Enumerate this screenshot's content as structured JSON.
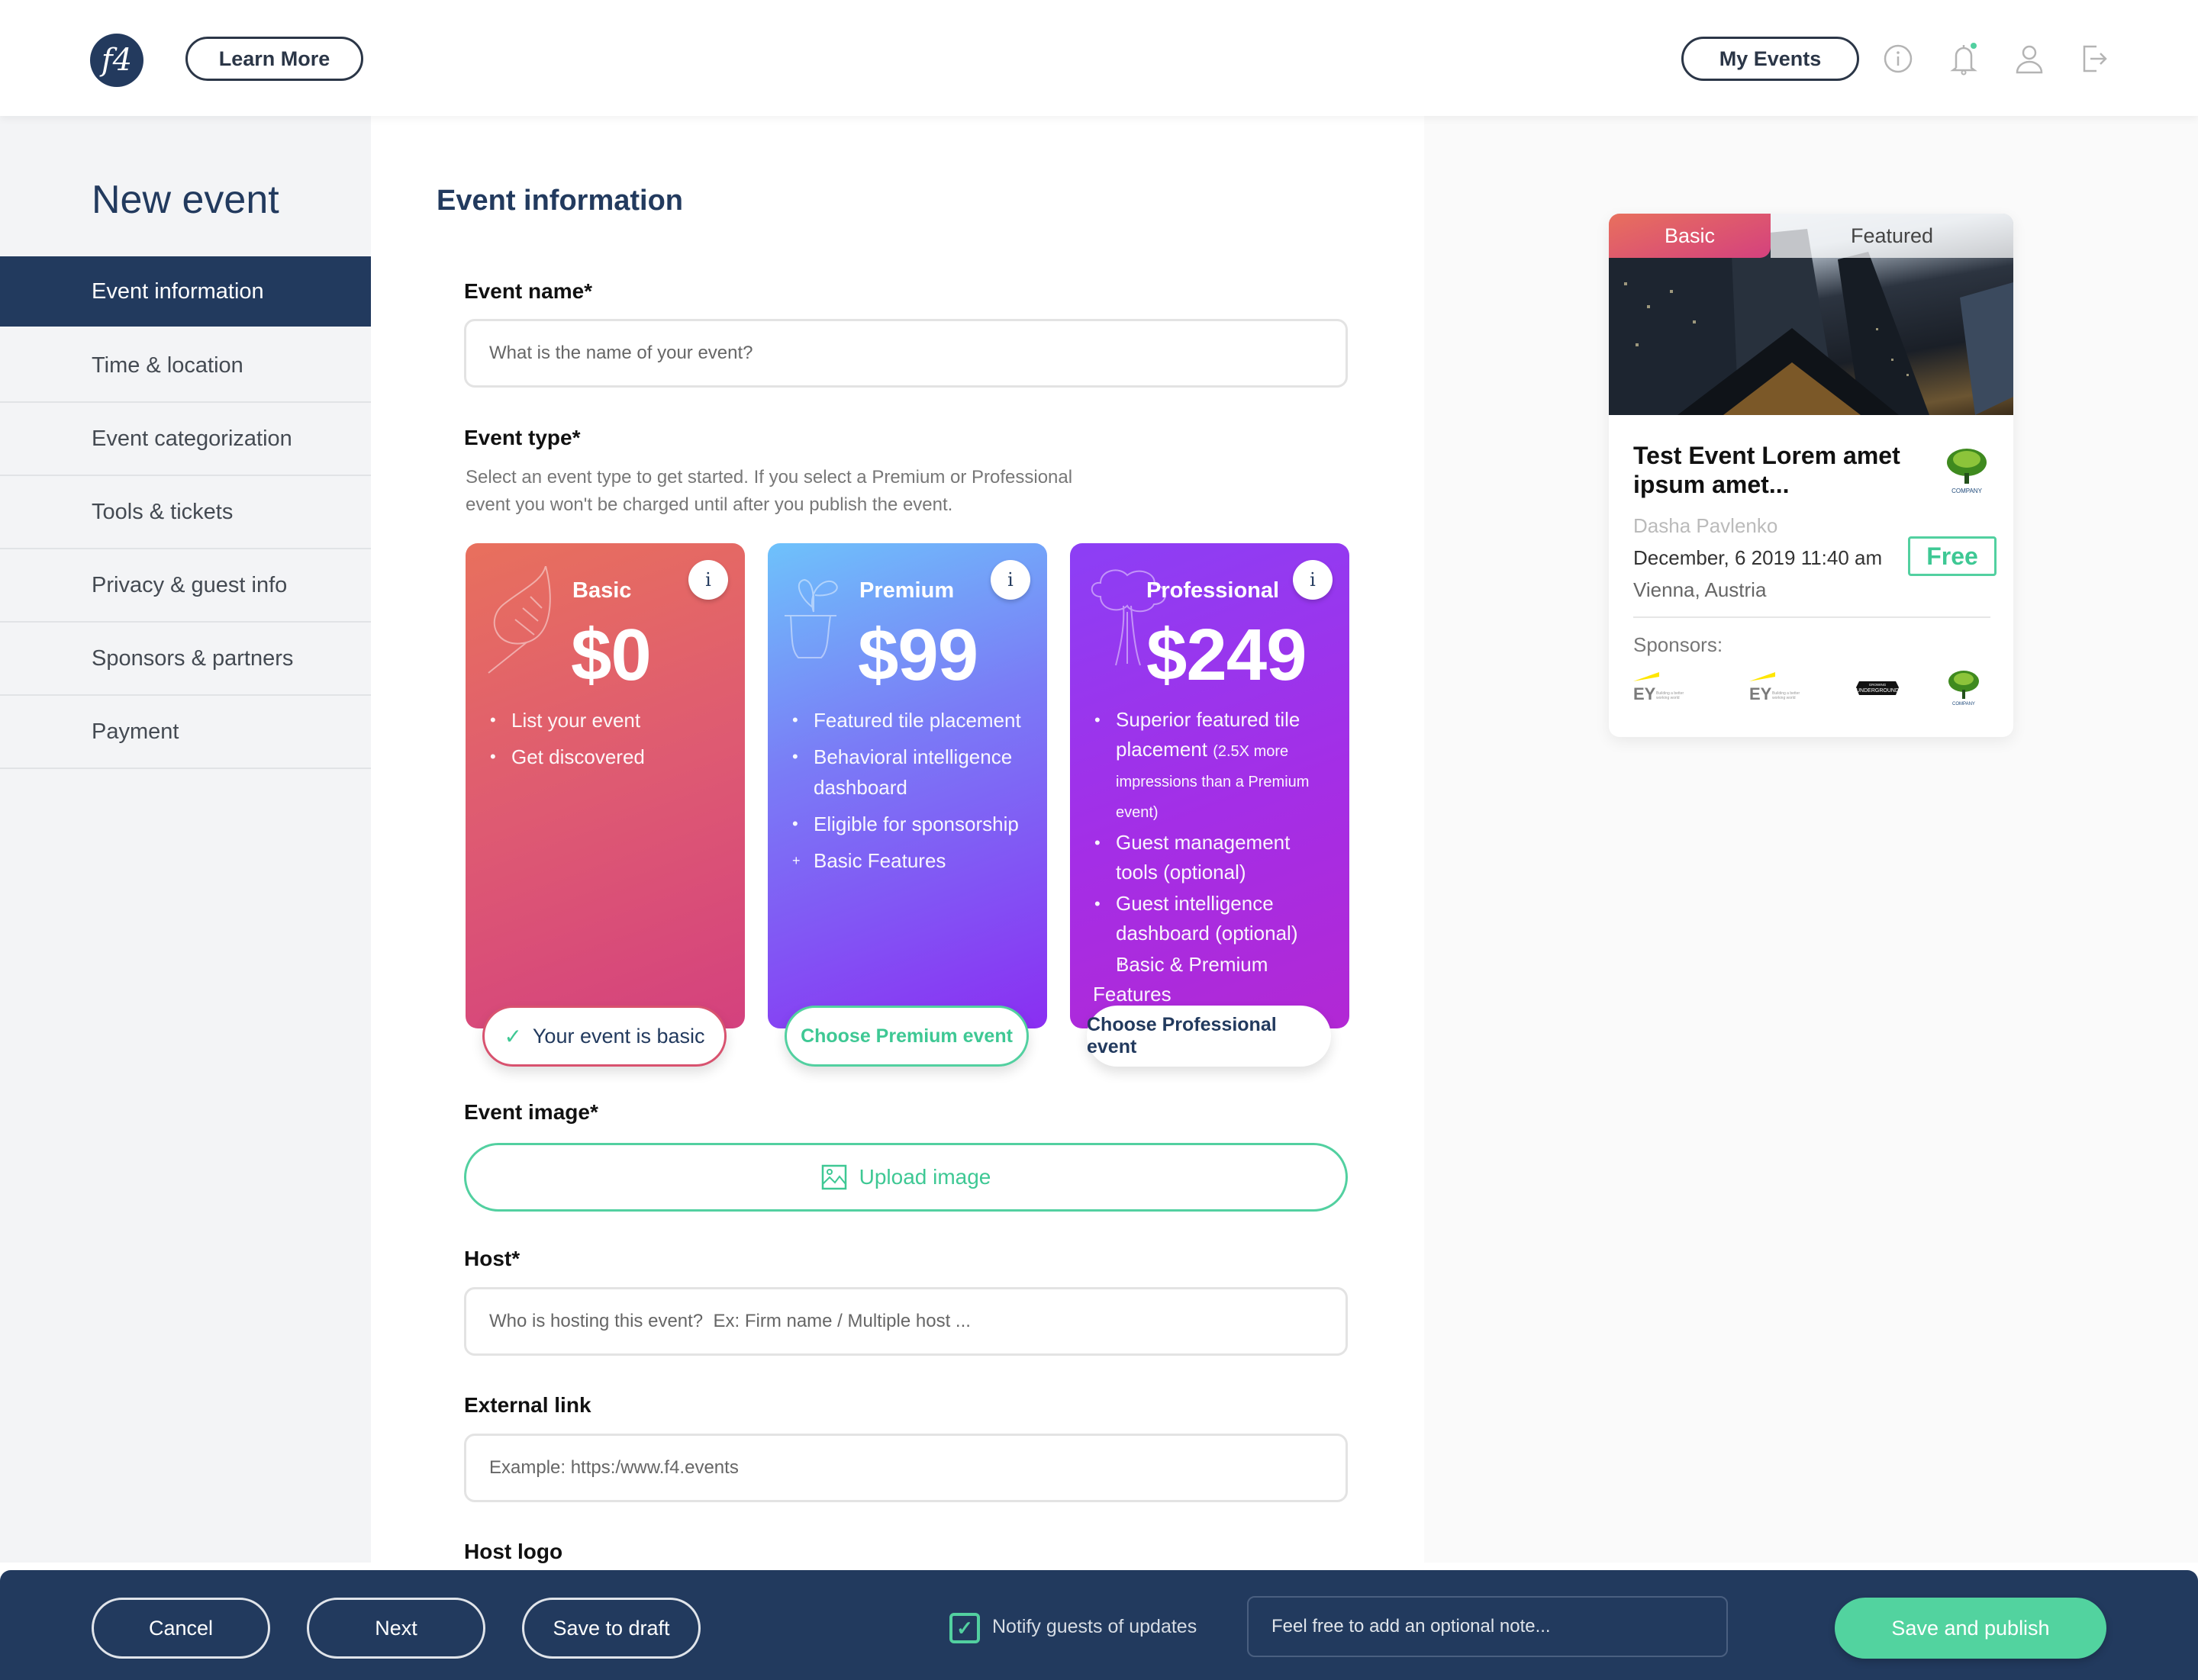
{
  "header": {
    "logo_text": "f4",
    "learn_more": "Learn More",
    "my_events": "My Events",
    "icons": [
      "info-icon",
      "bell-icon",
      "user-icon",
      "logout-icon"
    ],
    "notification_dot_color": "#52d0a0"
  },
  "sidebar": {
    "title": "New event",
    "items": [
      {
        "label": "Event information",
        "active": true
      },
      {
        "label": "Time & location"
      },
      {
        "label": "Event categorization"
      },
      {
        "label": "Tools & tickets"
      },
      {
        "label": "Privacy & guest info"
      },
      {
        "label": "Sponsors & partners"
      },
      {
        "label": "Payment"
      }
    ]
  },
  "form": {
    "section_title": "Event information",
    "event_name": {
      "label": "Event name*",
      "placeholder": "What is the name of your event?",
      "value": ""
    },
    "event_type": {
      "label": "Event type*",
      "helper": "Select an event type to get started. If you select a Premium or Professional event you won't be charged until after you publish the event.",
      "selected": "Basic",
      "cards": [
        {
          "name": "Basic",
          "price": "$0",
          "info": "i",
          "features": [
            "List your event",
            "Get discovered"
          ],
          "extra": "",
          "cta": "Your event is basic"
        },
        {
          "name": "Premium",
          "price": "$99",
          "info": "i",
          "features": [
            "Featured tile placement",
            "Behavioral intelligence dashboard",
            "Eligible for sponsorship"
          ],
          "extra": "Basic Features",
          "cta": "Choose Premium event"
        },
        {
          "name": "Professional",
          "price": "$249",
          "info": "i",
          "features": [
            "Superior featured tile placement",
            "Guest management tools (optional)",
            "Guest intelligence dashboard (optional)"
          ],
          "feature_note": "(2.5X more impressions than a Premium event)",
          "extra": "Basic & Premium Features",
          "cta": "Choose Professional event"
        }
      ]
    },
    "event_image": {
      "label": "Event image*",
      "button": "Upload image"
    },
    "host": {
      "label": "Host*",
      "placeholder": "Who is hosting this event?  Ex: Firm name / Multiple host ...",
      "value": ""
    },
    "external_link": {
      "label": "External link",
      "placeholder": "Example: https:/www.f4.events",
      "value": ""
    },
    "host_logo": {
      "label": "Host logo"
    }
  },
  "preview": {
    "tabs": [
      "Basic",
      "Featured"
    ],
    "active_tab": "Basic",
    "title": "Test Event Lorem amet ipsum amet...",
    "host": "Dasha Pavlenko",
    "date": "December, 6 2019 11:40 am",
    "location": "Vienna, Austria",
    "price_badge": "Free",
    "sponsors_label": "Sponsors:",
    "sponsors": [
      "EY Building a better working world",
      "EY Building a better working world",
      "Growing Underground",
      "Company"
    ],
    "host_logo_text": "COMPANY"
  },
  "footer": {
    "cancel": "Cancel",
    "next": "Next",
    "save_draft": "Save to draft",
    "notify_label": "Notify guests of updates",
    "notify_checked": true,
    "note_placeholder": "Feel free to add an optional note...",
    "note_value": "",
    "publish": "Save and publish"
  },
  "colors": {
    "navy": "#223a5e",
    "accent_green": "#52d0a0",
    "basic_gradient": [
      "#e8705d",
      "#d4417e"
    ],
    "premium_gradient": [
      "#6ec2fb",
      "#8a2ef2"
    ],
    "professional_gradient": [
      "#8c3ff5",
      "#b228d4"
    ]
  }
}
